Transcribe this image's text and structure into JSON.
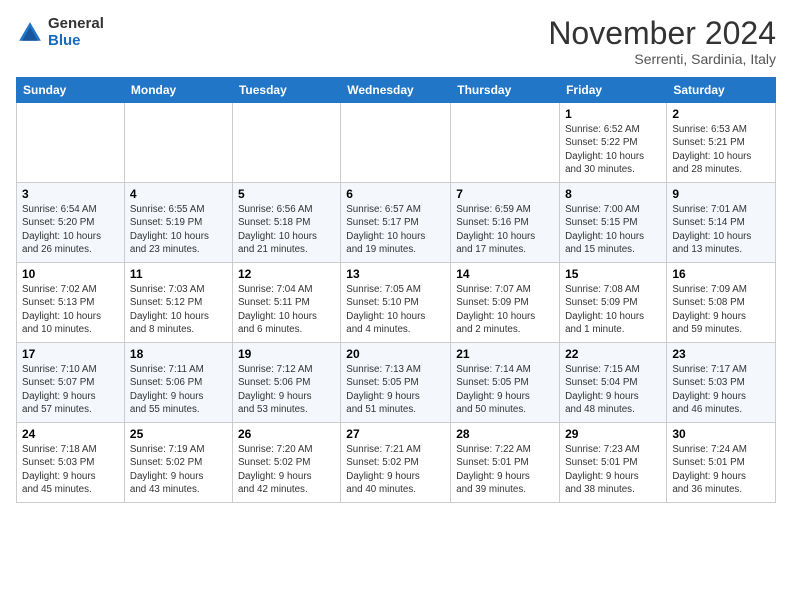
{
  "header": {
    "logo_general": "General",
    "logo_blue": "Blue",
    "month": "November 2024",
    "location": "Serrenti, Sardinia, Italy"
  },
  "columns": [
    "Sunday",
    "Monday",
    "Tuesday",
    "Wednesday",
    "Thursday",
    "Friday",
    "Saturday"
  ],
  "weeks": [
    [
      {
        "day": "",
        "info": ""
      },
      {
        "day": "",
        "info": ""
      },
      {
        "day": "",
        "info": ""
      },
      {
        "day": "",
        "info": ""
      },
      {
        "day": "",
        "info": ""
      },
      {
        "day": "1",
        "info": "Sunrise: 6:52 AM\nSunset: 5:22 PM\nDaylight: 10 hours\nand 30 minutes."
      },
      {
        "day": "2",
        "info": "Sunrise: 6:53 AM\nSunset: 5:21 PM\nDaylight: 10 hours\nand 28 minutes."
      }
    ],
    [
      {
        "day": "3",
        "info": "Sunrise: 6:54 AM\nSunset: 5:20 PM\nDaylight: 10 hours\nand 26 minutes."
      },
      {
        "day": "4",
        "info": "Sunrise: 6:55 AM\nSunset: 5:19 PM\nDaylight: 10 hours\nand 23 minutes."
      },
      {
        "day": "5",
        "info": "Sunrise: 6:56 AM\nSunset: 5:18 PM\nDaylight: 10 hours\nand 21 minutes."
      },
      {
        "day": "6",
        "info": "Sunrise: 6:57 AM\nSunset: 5:17 PM\nDaylight: 10 hours\nand 19 minutes."
      },
      {
        "day": "7",
        "info": "Sunrise: 6:59 AM\nSunset: 5:16 PM\nDaylight: 10 hours\nand 17 minutes."
      },
      {
        "day": "8",
        "info": "Sunrise: 7:00 AM\nSunset: 5:15 PM\nDaylight: 10 hours\nand 15 minutes."
      },
      {
        "day": "9",
        "info": "Sunrise: 7:01 AM\nSunset: 5:14 PM\nDaylight: 10 hours\nand 13 minutes."
      }
    ],
    [
      {
        "day": "10",
        "info": "Sunrise: 7:02 AM\nSunset: 5:13 PM\nDaylight: 10 hours\nand 10 minutes."
      },
      {
        "day": "11",
        "info": "Sunrise: 7:03 AM\nSunset: 5:12 PM\nDaylight: 10 hours\nand 8 minutes."
      },
      {
        "day": "12",
        "info": "Sunrise: 7:04 AM\nSunset: 5:11 PM\nDaylight: 10 hours\nand 6 minutes."
      },
      {
        "day": "13",
        "info": "Sunrise: 7:05 AM\nSunset: 5:10 PM\nDaylight: 10 hours\nand 4 minutes."
      },
      {
        "day": "14",
        "info": "Sunrise: 7:07 AM\nSunset: 5:09 PM\nDaylight: 10 hours\nand 2 minutes."
      },
      {
        "day": "15",
        "info": "Sunrise: 7:08 AM\nSunset: 5:09 PM\nDaylight: 10 hours\nand 1 minute."
      },
      {
        "day": "16",
        "info": "Sunrise: 7:09 AM\nSunset: 5:08 PM\nDaylight: 9 hours\nand 59 minutes."
      }
    ],
    [
      {
        "day": "17",
        "info": "Sunrise: 7:10 AM\nSunset: 5:07 PM\nDaylight: 9 hours\nand 57 minutes."
      },
      {
        "day": "18",
        "info": "Sunrise: 7:11 AM\nSunset: 5:06 PM\nDaylight: 9 hours\nand 55 minutes."
      },
      {
        "day": "19",
        "info": "Sunrise: 7:12 AM\nSunset: 5:06 PM\nDaylight: 9 hours\nand 53 minutes."
      },
      {
        "day": "20",
        "info": "Sunrise: 7:13 AM\nSunset: 5:05 PM\nDaylight: 9 hours\nand 51 minutes."
      },
      {
        "day": "21",
        "info": "Sunrise: 7:14 AM\nSunset: 5:05 PM\nDaylight: 9 hours\nand 50 minutes."
      },
      {
        "day": "22",
        "info": "Sunrise: 7:15 AM\nSunset: 5:04 PM\nDaylight: 9 hours\nand 48 minutes."
      },
      {
        "day": "23",
        "info": "Sunrise: 7:17 AM\nSunset: 5:03 PM\nDaylight: 9 hours\nand 46 minutes."
      }
    ],
    [
      {
        "day": "24",
        "info": "Sunrise: 7:18 AM\nSunset: 5:03 PM\nDaylight: 9 hours\nand 45 minutes."
      },
      {
        "day": "25",
        "info": "Sunrise: 7:19 AM\nSunset: 5:02 PM\nDaylight: 9 hours\nand 43 minutes."
      },
      {
        "day": "26",
        "info": "Sunrise: 7:20 AM\nSunset: 5:02 PM\nDaylight: 9 hours\nand 42 minutes."
      },
      {
        "day": "27",
        "info": "Sunrise: 7:21 AM\nSunset: 5:02 PM\nDaylight: 9 hours\nand 40 minutes."
      },
      {
        "day": "28",
        "info": "Sunrise: 7:22 AM\nSunset: 5:01 PM\nDaylight: 9 hours\nand 39 minutes."
      },
      {
        "day": "29",
        "info": "Sunrise: 7:23 AM\nSunset: 5:01 PM\nDaylight: 9 hours\nand 38 minutes."
      },
      {
        "day": "30",
        "info": "Sunrise: 7:24 AM\nSunset: 5:01 PM\nDaylight: 9 hours\nand 36 minutes."
      }
    ]
  ]
}
